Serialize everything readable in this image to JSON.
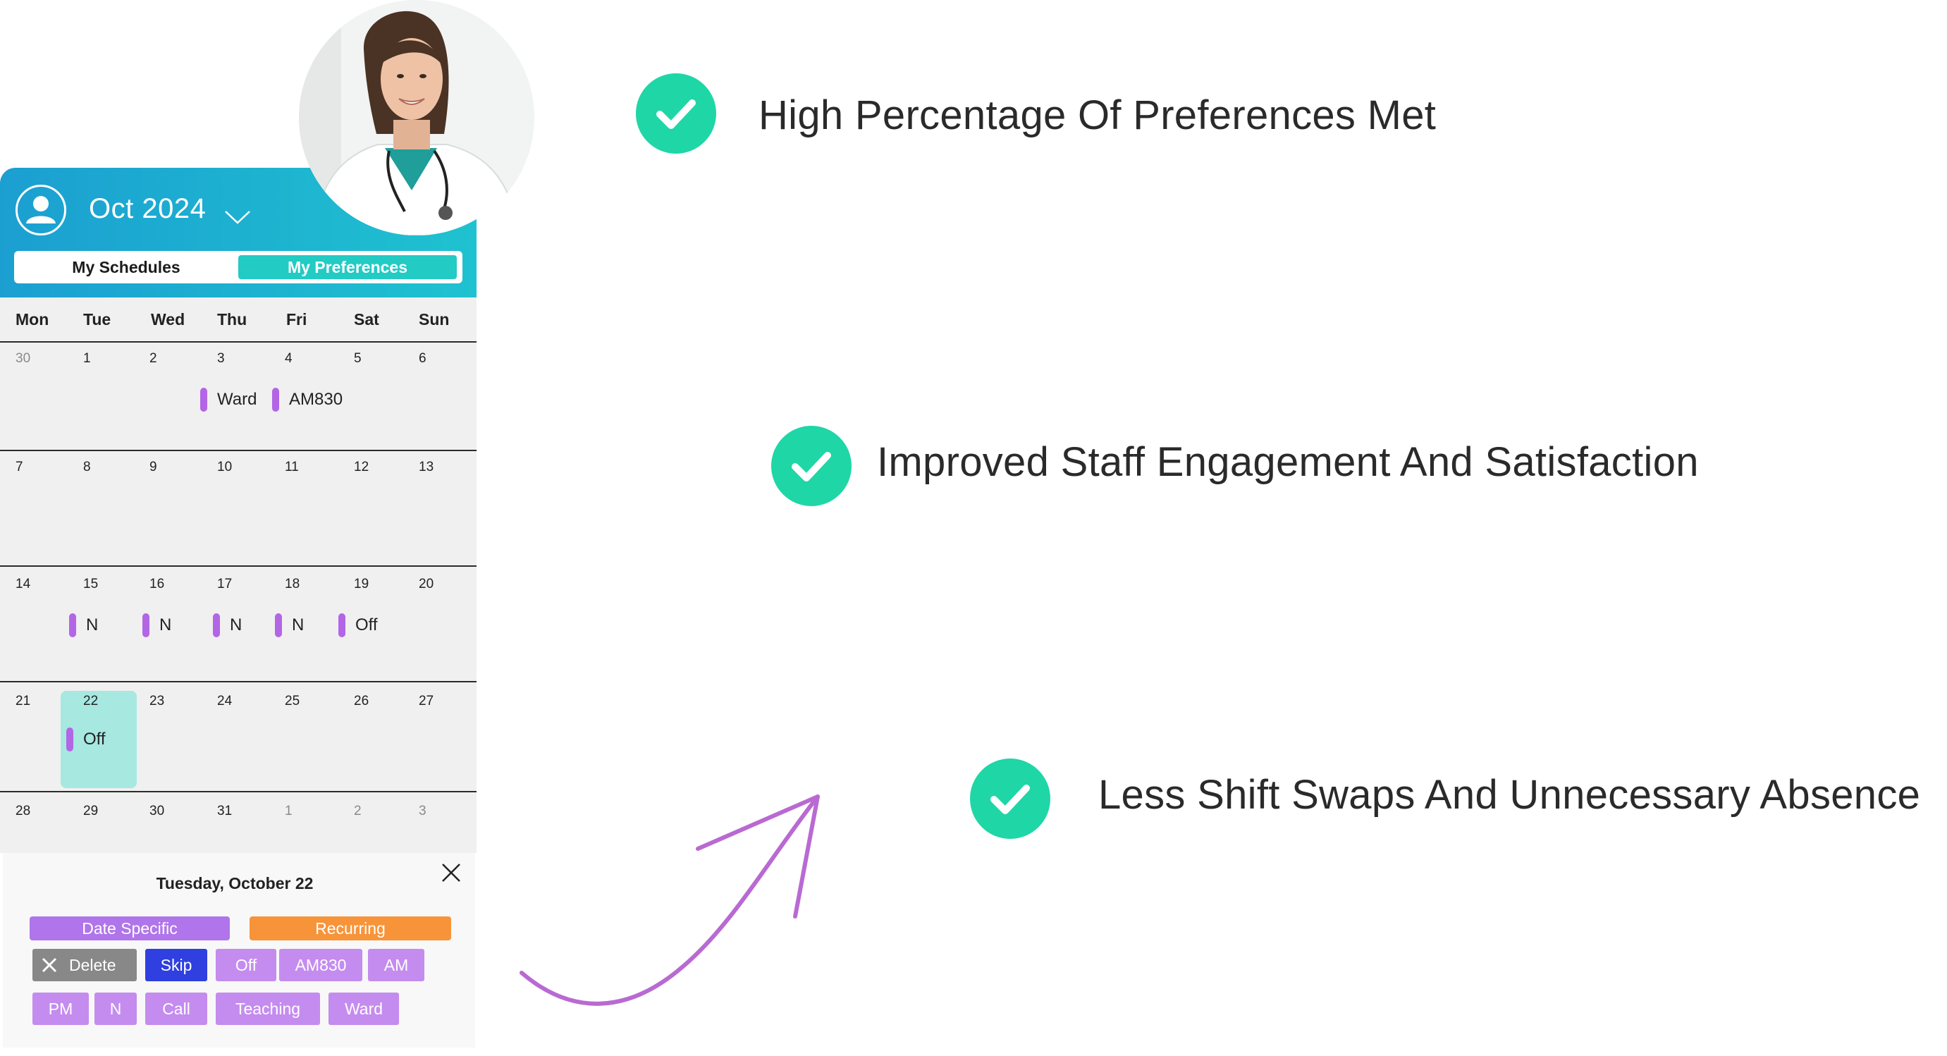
{
  "calendar": {
    "month_label": "Oct 2024",
    "tabs": {
      "my_schedules": "My Schedules",
      "my_preferences": "My Preferences"
    },
    "weekdays": [
      "Mon",
      "Tue",
      "Wed",
      "Thu",
      "Fri",
      "Sat",
      "Sun"
    ],
    "weeks": [
      [
        "30",
        "1",
        "2",
        "3",
        "4",
        "5",
        "6"
      ],
      [
        "7",
        "8",
        "9",
        "10",
        "11",
        "12",
        "13"
      ],
      [
        "14",
        "15",
        "16",
        "17",
        "18",
        "19",
        "20"
      ],
      [
        "21",
        "22",
        "23",
        "24",
        "25",
        "26",
        "27"
      ],
      [
        "28",
        "29",
        "30",
        "31",
        "1",
        "2",
        "3"
      ]
    ],
    "events": {
      "w1_thu": "Ward",
      "w1_fri": "AM830",
      "w3_tue": "N",
      "w3_wed": "N",
      "w3_thu": "N",
      "w3_fri": "N",
      "w3_sat": "Off",
      "w4_tue": "Off"
    },
    "selected_date": "22",
    "event_color": "#b266e6",
    "selected_color": "#a7e8e0"
  },
  "sheet": {
    "title": "Tuesday, October 22",
    "mode_tabs": {
      "date_specific": "Date Specific",
      "recurring": "Recurring"
    },
    "chips_row1": {
      "delete": "Delete",
      "skip": "Skip",
      "off": "Off",
      "am830": "AM830",
      "am": "AM"
    },
    "chips_row2": {
      "pm": "PM",
      "n": "N",
      "call": "Call",
      "teaching": "Teaching",
      "ward": "Ward"
    },
    "colors": {
      "date_specific": "#b075ea",
      "recurring": "#f7943a",
      "delete": "#888888",
      "skip": "#2f3fe0",
      "chip": "#c48cef"
    }
  },
  "benefits": {
    "item1": "High Percentage Of Preferences Met",
    "item2": "Improved Staff Engagement And Satisfaction",
    "item3": "Less Shift Swaps And Unnecessary Absence",
    "check_color": "#1fd6a6",
    "arrow_color": "#b96ad2"
  }
}
